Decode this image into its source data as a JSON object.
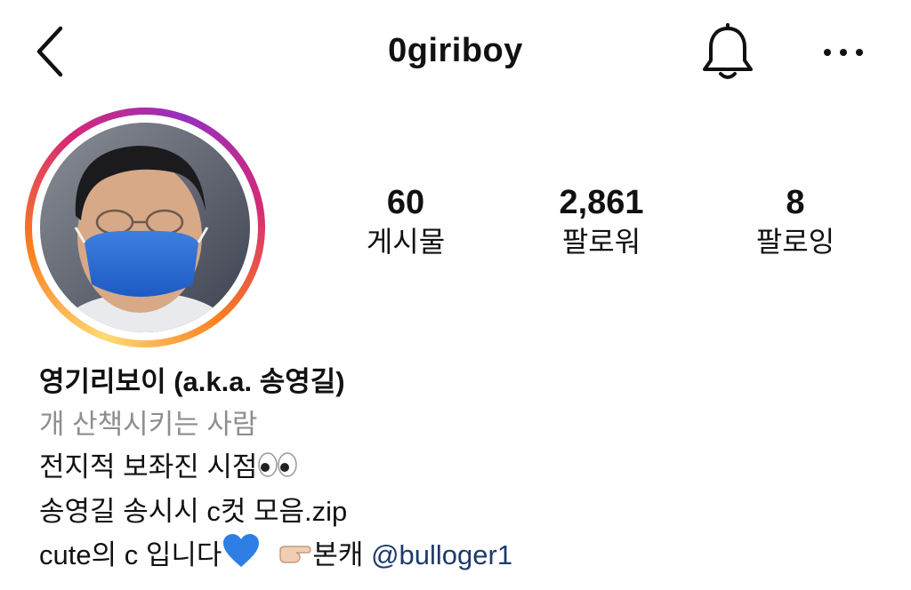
{
  "header": {
    "username": "0giriboy"
  },
  "icons": {
    "back": "chevron-left-icon",
    "notifications": "bell-icon",
    "more": "ellipsis-icon"
  },
  "stats": [
    {
      "value": "60",
      "label": "게시물"
    },
    {
      "value": "2,861",
      "label": "팔로워"
    },
    {
      "value": "8",
      "label": "팔로잉"
    }
  ],
  "bio": {
    "name": "영기리보이 (a.k.a. 송영길)",
    "category": "개 산책시키는 사람",
    "line1": "전지적 보좌진 시점",
    "line2": "송영길 송시시 c컷 모음.zip",
    "line3_text": "cute의 c 입니다",
    "line3_alt_label": "본캐",
    "mention": "@bulloger1"
  },
  "colors": {
    "mention": "#1e3a6e",
    "category": "#8e8e8e",
    "story_ring": [
      "#feda75",
      "#fa7e1e",
      "#d62976",
      "#962fbf"
    ]
  }
}
